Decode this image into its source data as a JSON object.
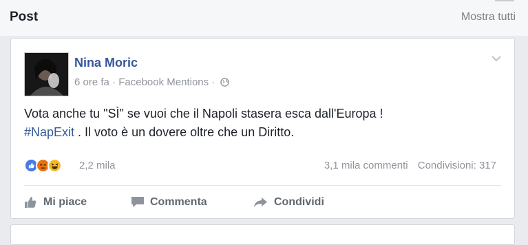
{
  "section": {
    "title": "Post",
    "show_all_label": "Mostra tutti"
  },
  "post": {
    "author": "Nina Moric",
    "time": "6 ore fa",
    "separator": "·",
    "source": "Facebook Mentions",
    "separator2": "·",
    "text_line1": "Vota anche tu \"SÌ\" se vuoi che il Napoli stasera esca dall'Europa !",
    "hashtag": "#NapExit",
    "text_line2": " . Il voto è un dovere oltre che un Diritto.",
    "reaction_count": "2,2 mila",
    "reactions": [
      "like-icon",
      "angry-icon",
      "haha-icon"
    ],
    "comments": "3,1 mila commenti",
    "shares": "Condivisioni: 317"
  },
  "actions": {
    "like": "Mi piace",
    "comment": "Commenta",
    "share": "Condividi"
  },
  "colors": {
    "link_blue": "#365899",
    "like_blue": "#4a7ae3",
    "angry_orange": "#e9710f",
    "haha_yellow": "#f7b928"
  }
}
